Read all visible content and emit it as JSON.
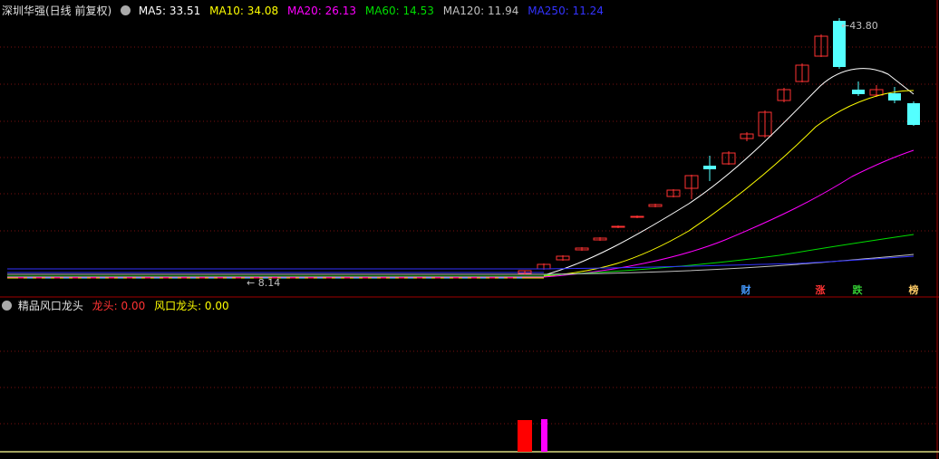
{
  "main_panel": {
    "stock_name": "深圳华强(日线 前复权)",
    "ma_items": [
      {
        "label": "MA5: 33.51",
        "color": "#ffffff"
      },
      {
        "label": "MA10: 34.08",
        "color": "#ffff00"
      },
      {
        "label": "MA20: 26.13",
        "color": "#ff00ff"
      },
      {
        "label": "MA60: 14.53",
        "color": "#00dd00"
      },
      {
        "label": "MA120: 11.94",
        "color": "#c0c0c0"
      },
      {
        "label": "MA250: 11.24",
        "color": "#3333ff"
      }
    ],
    "high_label": "43.80",
    "low_label": "8.14",
    "event_badges": [
      {
        "text": "财",
        "color": "#4499ff"
      },
      {
        "text": "涨",
        "color": "#ff3333"
      },
      {
        "text": "跌",
        "color": "#33cc33"
      },
      {
        "text": "榜",
        "color": "#ffcc66"
      }
    ]
  },
  "sub_panel": {
    "indicator_name": "精品风口龙头",
    "items": [
      {
        "label": "龙头: 0.00",
        "color": "#ff3333"
      },
      {
        "label": "风口龙头: 0.00",
        "color": "#ffff00"
      }
    ]
  },
  "colors": {
    "background": "#000000",
    "grid": "#7a1010",
    "up_candle": "#ff3232",
    "down_candle": "#54ffff",
    "divider": "#a00000"
  }
}
